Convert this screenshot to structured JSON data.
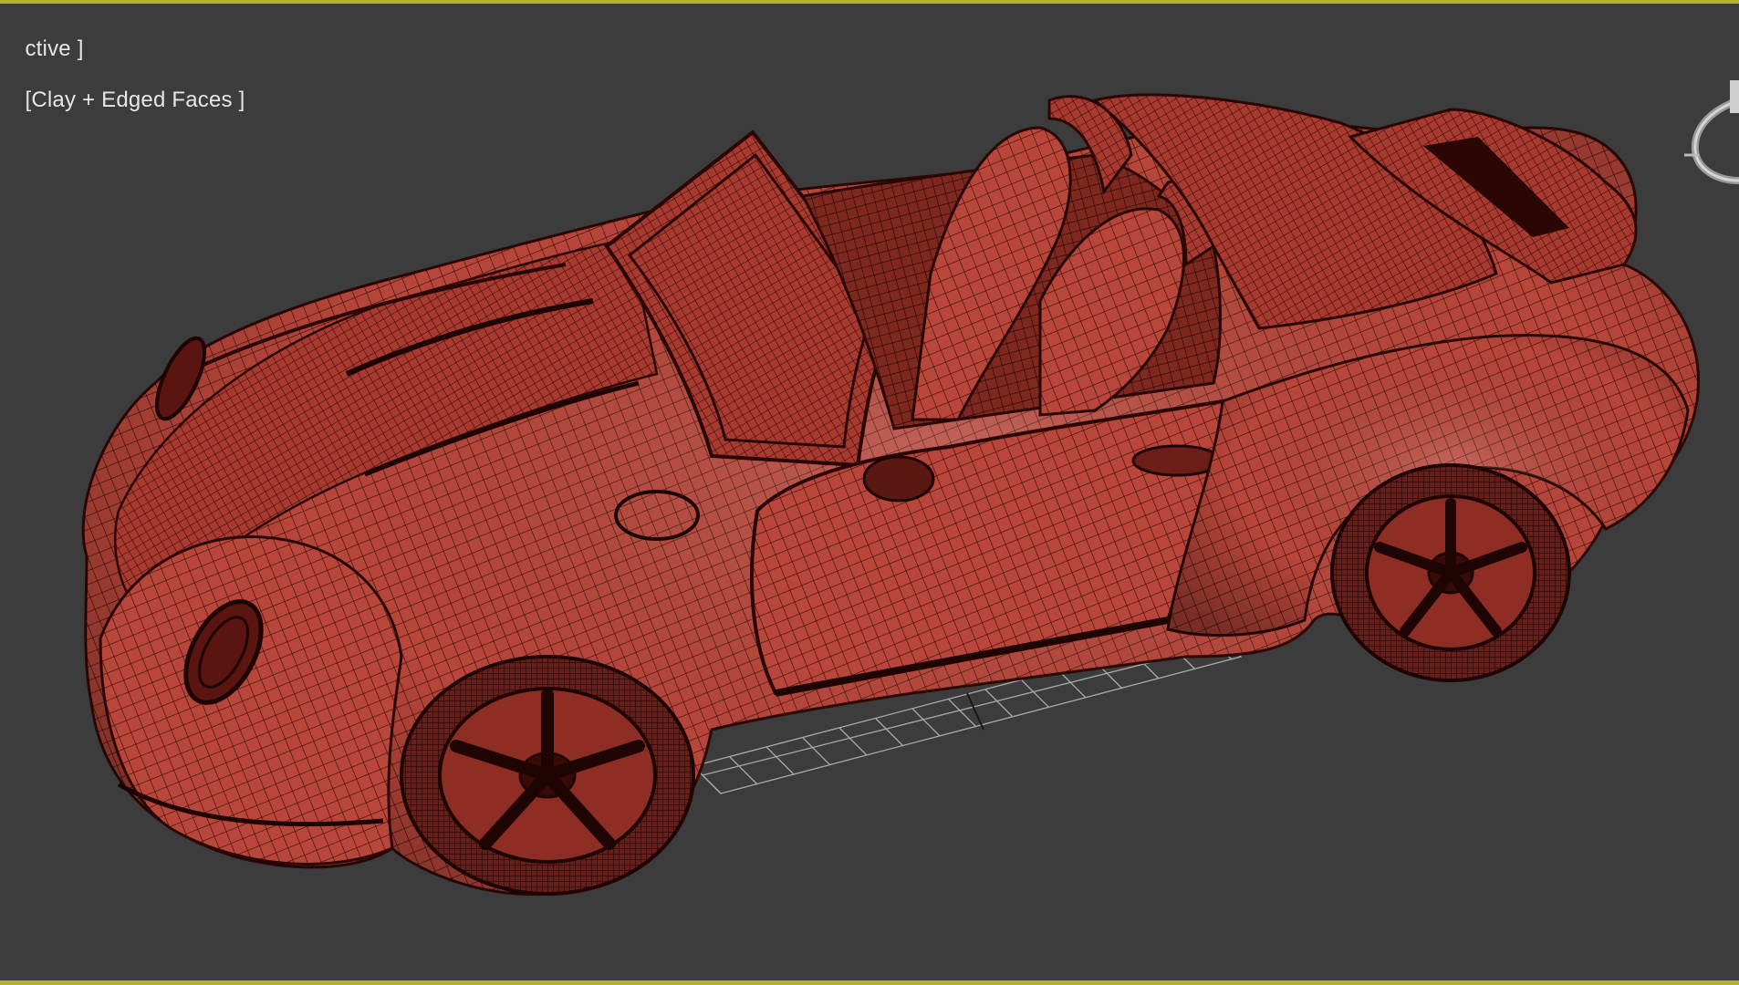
{
  "viewport": {
    "view_label": "ctive ]",
    "shading_label": "[Clay + Edged Faces ]",
    "active_border_color": "#b3b32a",
    "background_color": "#3c3c3c"
  },
  "scene": {
    "object": "convertible-sports-car-wireframe",
    "model_color": "#b8463a",
    "wire_color": "#3a0c08",
    "grid_color": "#bdbdbd"
  },
  "icons": {
    "viewcube": "viewcube-ring-icon"
  }
}
